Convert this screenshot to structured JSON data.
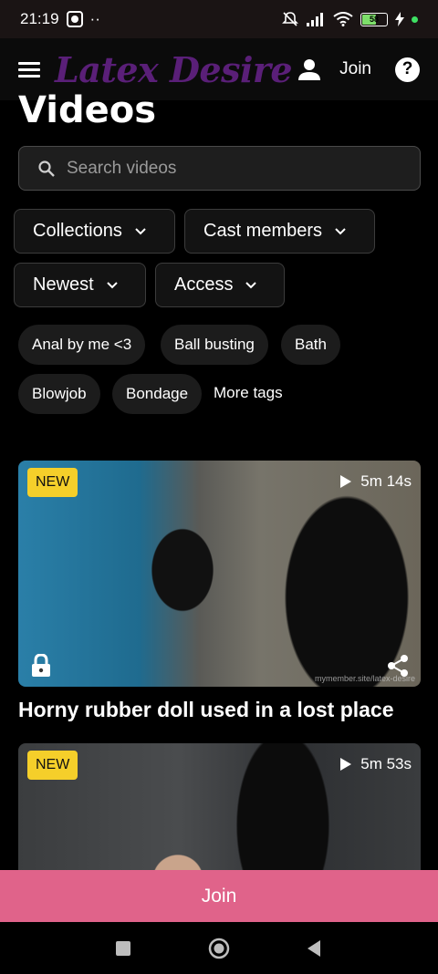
{
  "status_bar": {
    "time": "21:19",
    "dots": "··",
    "battery_level": "58",
    "icons": [
      "camera-icon",
      "mute-icon",
      "signal-icon",
      "wifi-icon",
      "battery-icon",
      "charging-icon"
    ]
  },
  "header": {
    "brand": "Latex Desire",
    "join_label": "Join",
    "help_label": "?"
  },
  "page": {
    "title": "Videos",
    "search_placeholder": "Search videos"
  },
  "filters": [
    "Collections",
    "Cast members",
    "Newest",
    "Access"
  ],
  "tags": [
    "Anal by me <3",
    "Ball busting",
    "Bath",
    "Blowjob",
    "Bondage"
  ],
  "more_tags_label": "More tags",
  "videos": [
    {
      "badge": "NEW",
      "duration": "5m 14s",
      "title": "Horny rubber doll used in a lost place",
      "watermark": "mymember.site/latex-desire"
    },
    {
      "badge": "NEW",
      "duration": "5m 53s"
    }
  ],
  "join_bar_label": "Join",
  "colors": {
    "brand": "#5a1f78",
    "badge": "#f5cf2a",
    "join_bar": "#e0638a",
    "background": "#000000"
  }
}
